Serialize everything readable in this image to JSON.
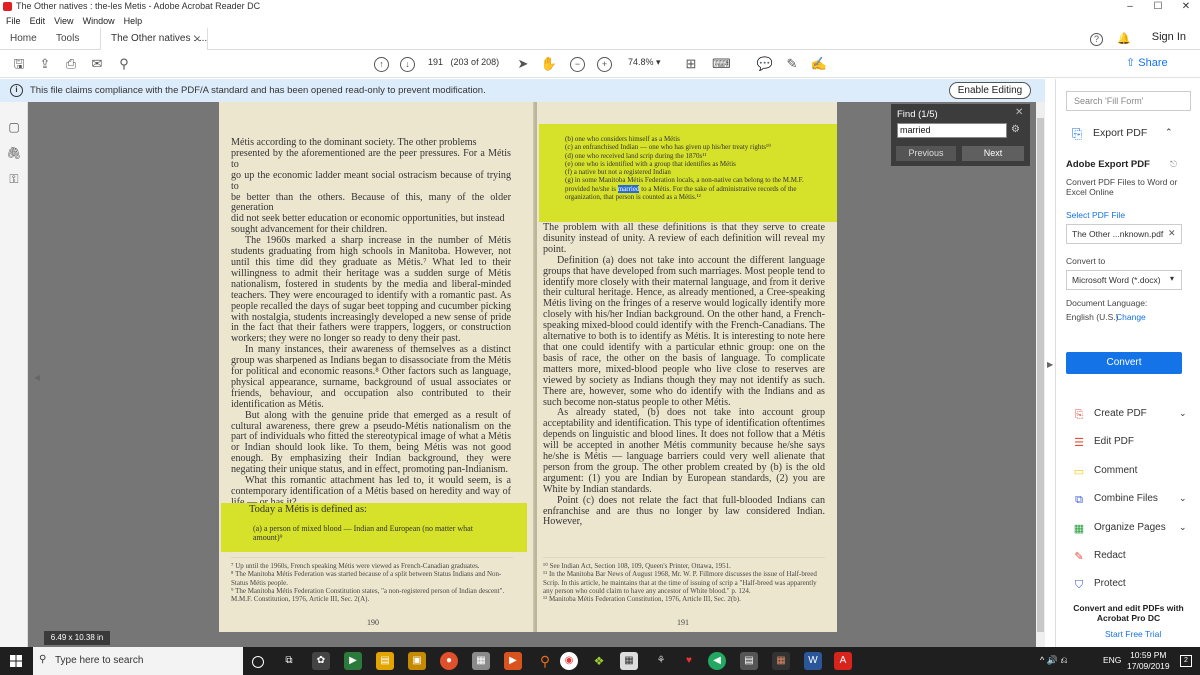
{
  "window": {
    "title": "The Other natives : the-les Metis - Adobe Acrobat Reader DC",
    "controls": [
      "–",
      "☐",
      "✕"
    ]
  },
  "menu": [
    "File",
    "Edit",
    "View",
    "Window",
    "Help"
  ],
  "tabs": {
    "home": "Home",
    "tools": "Tools",
    "document": "The Other natives : ...",
    "signin": "Sign In"
  },
  "toolbar": {
    "page_current": "191",
    "page_of": "(203 of 208)",
    "zoom": "74.8%",
    "share": "Share"
  },
  "notice": {
    "text": "This file claims compliance with the PDF/A standard and has been opened read-only to prevent modification.",
    "button": "Enable Editing"
  },
  "find": {
    "title": "Find (1/5)",
    "query": "married",
    "prev": "Previous",
    "next": "Next"
  },
  "left_page": {
    "lines": [
      "Métis according to the dominant society. The other problems",
      "presented by the aforementioned are the peer pressures. For a Métis to",
      "go up the economic ladder meant social ostracism because of trying to",
      "be better than the others. Because of this, many of the older generation",
      "did not seek better education or economic opportunities, but instead",
      "sought advancement for their children."
    ],
    "p2": "The 1960s marked a sharp increase in the number of Métis students graduating from high schools in Manitoba. However, not until this time did they graduate as Métis.⁷ What led to their willingness to admit their heritage was a sudden surge of Métis nationalism, fostered in students by the media and liberal-minded teachers. They were encouraged to identify with a romantic past. As people recalled the days of sugar beet topping and cucumber picking with nostalgia, students increasingly developed a new sense of pride in the fact that their fathers were trappers, loggers, or construction workers; they were no longer so ready to deny their past.",
    "p3": "In many instances, their awareness of themselves as a distinct group was sharpened as Indians began to disassociate from the Métis for political and economic reasons.⁸ Other factors such as language, physical appearance, surname, background of usual associates or friends, behaviour, and occupation also contributed to their identification as Métis.",
    "p4": "But along with the genuine pride that emerged as a result of cultural awareness, there grew a pseudo-Métis nationalism on the part of individuals who fitted the stereotypical image of what a Métis or Indian should look like. To them, being Métis was not good enough. By emphasizing their Indian background, they were negating their unique status, and in effect, promoting pan-Indianism.",
    "p5": "What this romantic attachment has led to, it would seem, is a contemporary identification of a Métis based on heredity and way of life — or has it?",
    "highlight_title": "Today a Métis is defined as:",
    "highlight_a": "(a) a person of mixed blood — Indian and European (no matter what amount)⁹",
    "footnotes": [
      "⁷ Up until the 1960s, French speaking Métis were viewed as French-Canadian graduates.",
      "⁸ The Manitoba Métis Federation was started because of a split between Status Indians and Non-Status Métis people.",
      "⁹ The Manitoba Métis Federation Constitution states, \"a non-registered person of Indian descent\". M.M.F. Constitution, 1976, Article III, Sec. 2(A)."
    ],
    "page_number": "190"
  },
  "right_page": {
    "defs": [
      "(b) one who considers himself as a Métis",
      "(c) an enfranchised Indian — one who has given up his/her treaty rights¹⁰",
      "(d) one who received land scrip during the 1870s¹¹",
      "(e) one who is identified with a group that identifies as Métis",
      "(f) a native but not a registered Indian"
    ],
    "def_g_1": "(g) in some Manitoba Métis Federation locals, a non-native can belong to the M.M.F. provided he/she is ",
    "def_g_match": "married",
    "def_g_2": " to a Métis. For the sake of administrative records of the organization, that person is counted as a Métis.¹²",
    "p1": "The problem with all these definitions is that they serve to create disunity instead of unity. A review of each definition will reveal my point.",
    "p2": "Definition (a) does not take into account the different language groups that have developed from such marriages. Most people tend to identify more closely with their maternal language, and from it derive their cultural heritage. Hence, as already mentioned, a Cree-speaking Métis living on the fringes of a reserve would logically identify more closely with his/her Indian background. On the other hand, a French-speaking mixed-blood could identify with the French-Canadians. The alternative to both is to identify as Métis. It is interesting to note here that one could identify with a particular ethnic group: one on the basis of race, the other on the basis of language. To complicate matters more, mixed-blood people who live close to reserves are viewed by society as Indians though they may not identify as such. There are, however, some who do identify with the Indians and as such become non-status people to other Métis.",
    "p3": "As already stated, (b) does not take into account group acceptability and identification. This type of identification oftentimes depends on linguistic and blood lines. It does not follow that a Métis will be accepted in another Métis community because he/she says he/she is Métis — language barriers could very well alienate that person from the group. The other problem created by (b) is the old argument: (1) you are Indian by European standards, (2) you are White by Indian standards.",
    "p4": "Point (c) does not relate the fact that full-blooded Indians can enfranchise and are thus no longer by law considered Indian. However,",
    "footnotes": [
      "¹⁰ See Indian Act, Section 108, 109, Queen's Printer, Ottawa, 1951.",
      "¹¹ In the Manitoba Bar News of August 1968, Mr. W. P. Fillmore discusses the issue of Half-breed Scrip. In this article, he maintains that at the time of issuing of scrip a \"Half-breed was apparently any person who could claim to have any ancestor of White blood.\" p. 124.",
      "¹² Manitoba Métis Federation Constitution, 1976, Article III, Sec. 2(b)."
    ],
    "page_number": "191"
  },
  "page_size_label": "6.49 x 10.38 in",
  "right_panel": {
    "search_placeholder": "Search 'Fill Form'",
    "export_title": "Export PDF",
    "adobe_export": "Adobe Export PDF",
    "convert_desc": "Convert PDF Files to Word or Excel Online",
    "select_pdf": "Select PDF File",
    "file_name": "The Other ...nknown.pdf",
    "convert_to": "Convert to",
    "format": "Microsoft Word (*.docx)",
    "doc_language": "Document Language:",
    "language": "English (U.S.)",
    "change": "Change",
    "convert": "Convert",
    "tools": [
      {
        "label": "Create PDF",
        "icon": "create-pdf-icon",
        "chevron": true,
        "color": "#e84c3d"
      },
      {
        "label": "Edit PDF",
        "icon": "edit-pdf-icon",
        "chevron": false,
        "color": "#e84c3d"
      },
      {
        "label": "Comment",
        "icon": "comment-icon",
        "chevron": false,
        "color": "#f2c500"
      },
      {
        "label": "Combine Files",
        "icon": "combine-files-icon",
        "chevron": true,
        "color": "#3b5bdb"
      },
      {
        "label": "Organize Pages",
        "icon": "organize-pages-icon",
        "chevron": true,
        "color": "#2e9e44"
      },
      {
        "label": "Redact",
        "icon": "redact-icon",
        "chevron": false,
        "color": "#e84c3d"
      },
      {
        "label": "Protect",
        "icon": "protect-icon",
        "chevron": false,
        "color": "#3b5bdb"
      }
    ],
    "promo_title": "Convert and edit PDFs with Acrobat Pro DC",
    "promo_link": "Start Free Trial"
  },
  "taskbar": {
    "search": "Type here to search",
    "lang": "ENG",
    "time": "10:59 PM",
    "date": "17/09/2019",
    "notif_count": "2"
  }
}
